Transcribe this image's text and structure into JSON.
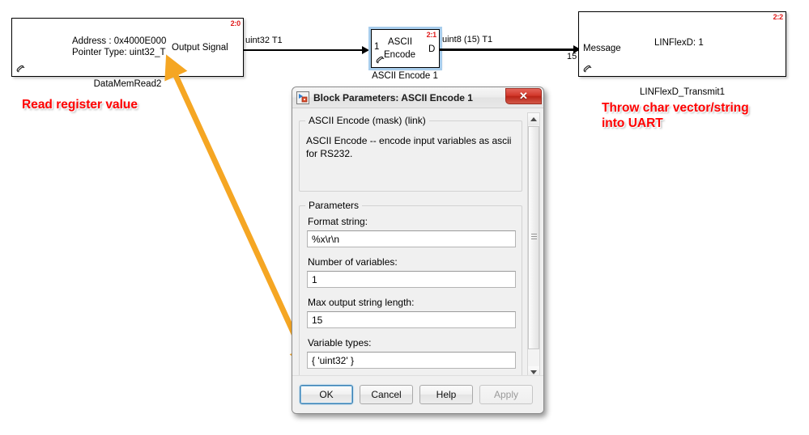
{
  "canvas": {
    "blocks": [
      {
        "id": "datamemread",
        "tag": "2:0",
        "inner_line1": "Address : 0x4000E000",
        "inner_line2": "Pointer Type: uint32_T",
        "port_out_label": "Output Signal",
        "name": "DataMemRead2"
      },
      {
        "id": "ascii-encode",
        "tag": "2:1",
        "inner_line1": "ASCII",
        "inner_line2": "Encode",
        "port_in_label": "1",
        "port_out_label": "D",
        "name": "ASCII Encode 1"
      },
      {
        "id": "linflexd",
        "tag": "2:2",
        "inner_line1": "LINFlexD: 1",
        "port_in_label": "Message",
        "name": "LINFlexD_Transmit1"
      }
    ],
    "signals": [
      {
        "id": "sig1",
        "label": "uint32 T1"
      },
      {
        "id": "sig2",
        "label": "uint8 (15) T1",
        "width": "15"
      }
    ],
    "annotations": [
      {
        "id": "annot-left",
        "text": "Read register value",
        "color": "#ff0000"
      },
      {
        "id": "annot-right",
        "text": "Throw char vector/string\ninto UART",
        "color": "#ff0000"
      }
    ],
    "arrow_color": "#f5a623"
  },
  "dialog": {
    "title": "Block Parameters: ASCII Encode 1",
    "close_label": "✕",
    "description_group_title": "ASCII Encode (mask) (link)",
    "description_text": "ASCII Encode -- encode input variables as ascii for RS232.",
    "parameters_group_title": "Parameters",
    "fields": [
      {
        "id": "format-string",
        "label": "Format string:",
        "value": "%x\\r\\n"
      },
      {
        "id": "num-variables",
        "label": "Number of variables:",
        "value": "1"
      },
      {
        "id": "max-output-string-length",
        "label": "Max output string length:",
        "value": "15"
      },
      {
        "id": "variable-types",
        "label": "Variable types:",
        "value": "{ 'uint32' }"
      }
    ],
    "buttons": [
      {
        "id": "ok",
        "label": "OK",
        "state": "focused"
      },
      {
        "id": "cancel",
        "label": "Cancel",
        "state": "normal"
      },
      {
        "id": "help",
        "label": "Help",
        "state": "normal"
      },
      {
        "id": "apply",
        "label": "Apply",
        "state": "disabled"
      }
    ]
  }
}
